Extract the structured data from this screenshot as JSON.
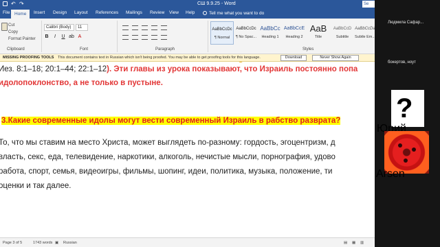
{
  "titlebar": {
    "doc_title": "СШ 9.9.25  -  Word",
    "signin": "Se"
  },
  "tabs": [
    "File",
    "Home",
    "Insert",
    "Design",
    "Layout",
    "References",
    "Mailings",
    "Review",
    "View",
    "Help"
  ],
  "active_tab": "Home",
  "tell_me": "Tell me what you want to do",
  "clipboard": {
    "cut": "Cut",
    "copy": "Copy",
    "format_painter": "Format Painter",
    "label": "Clipboard"
  },
  "font": {
    "family": "Calibri (Body)",
    "size": "11",
    "label": "Font"
  },
  "paragraph_label": "Paragraph",
  "styles": {
    "label": "Styles",
    "items": [
      {
        "sample": "AaBbCcDc",
        "name": "¶ Normal"
      },
      {
        "sample": "AaBbCcDc",
        "name": "¶ No Spac..."
      },
      {
        "sample": "AaBbCc",
        "name": "Heading 1"
      },
      {
        "sample": "AaBbCcE",
        "name": "Heading 2"
      },
      {
        "sample": "AaB",
        "name": "Title"
      },
      {
        "sample": "AaBbCcD",
        "name": "Subtitle"
      },
      {
        "sample": "AaBbCcDa",
        "name": "Subtle Em..."
      }
    ]
  },
  "message_bar": {
    "title": "MISSING PROOFING TOOLS",
    "text": "This document contains text in Russian which isn't being proofed. You may be able to get proofing tools for this language.",
    "download": "Download",
    "never_show": "Never Show Again"
  },
  "document": {
    "line1_ref": "Иез. 8:1–18; 20:1–44; 22:1–12",
    "line1_tail": ").  Эти главы из урока показывают, что Израиль постоянно попа",
    "line2": "идолопоклонство, а не только в пустыне.",
    "question": " 3.Какие современные идолы могут вести современный Израиль в рабство разврата?",
    "answer": [
      "То, что мы ставим на место Христа, может выглядеть по-разному: гордость, эгоцентризм, д",
      "власть, секс, еда, телевидение, наркотики, алкоголь, нечистые мысли, порнография, удово",
      "работа, спорт, семья, видеоигры, фильмы, шопинг, идеи, политика, музыка, положение, ти",
      "оценки и так далее."
    ]
  },
  "status": {
    "page": "Page 3 of 5",
    "words": "1743 words",
    "language": "Russian"
  },
  "participants": [
    {
      "name": "Людмила Сафар..."
    },
    {
      "name": "бокертов, ноут"
    },
    {
      "name": "Юрий"
    },
    {
      "name": "Arsen"
    }
  ]
}
